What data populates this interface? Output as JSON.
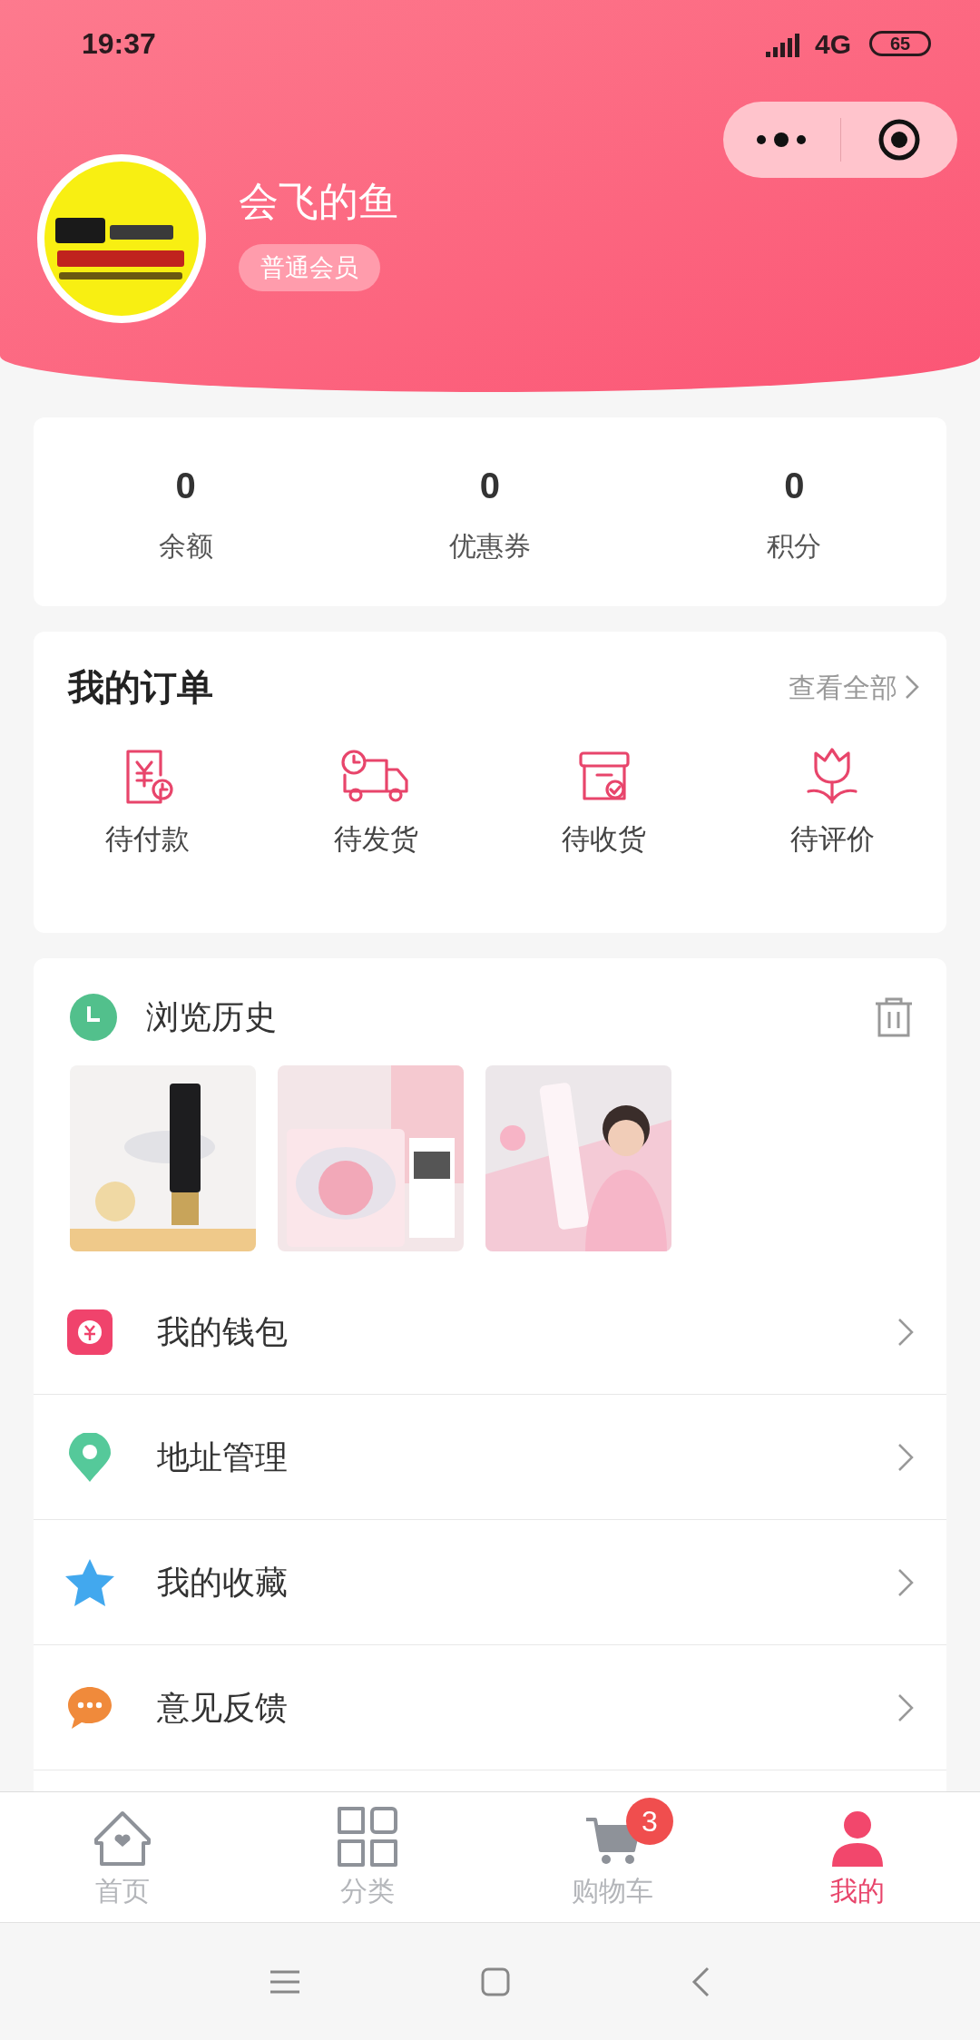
{
  "status_bar": {
    "time": "19:37",
    "network": "4G",
    "battery": "65"
  },
  "profile": {
    "name": "会飞的鱼",
    "badge": "普通会员"
  },
  "stats": [
    {
      "value": "0",
      "label": "余额"
    },
    {
      "value": "0",
      "label": "优惠券"
    },
    {
      "value": "0",
      "label": "积分"
    }
  ],
  "orders": {
    "title": "我的订单",
    "link": "查看全部",
    "items": [
      {
        "label": "待付款",
        "kind": "pay"
      },
      {
        "label": "待发货",
        "kind": "ship"
      },
      {
        "label": "待收货",
        "kind": "receive"
      },
      {
        "label": "待评价",
        "kind": "review"
      }
    ]
  },
  "history": {
    "title": "浏览历史"
  },
  "menu": [
    {
      "label": "我的钱包",
      "kind": "wallet"
    },
    {
      "label": "地址管理",
      "kind": "address"
    },
    {
      "label": "我的收藏",
      "kind": "favorite"
    },
    {
      "label": "意见反馈",
      "kind": "feedback"
    }
  ],
  "tabs": [
    {
      "label": "首页",
      "kind": "home",
      "selected": false
    },
    {
      "label": "分类",
      "kind": "category",
      "selected": false
    },
    {
      "label": "购物车",
      "kind": "cart",
      "selected": false,
      "badge": "3"
    },
    {
      "label": "我的",
      "kind": "me",
      "selected": true
    }
  ]
}
